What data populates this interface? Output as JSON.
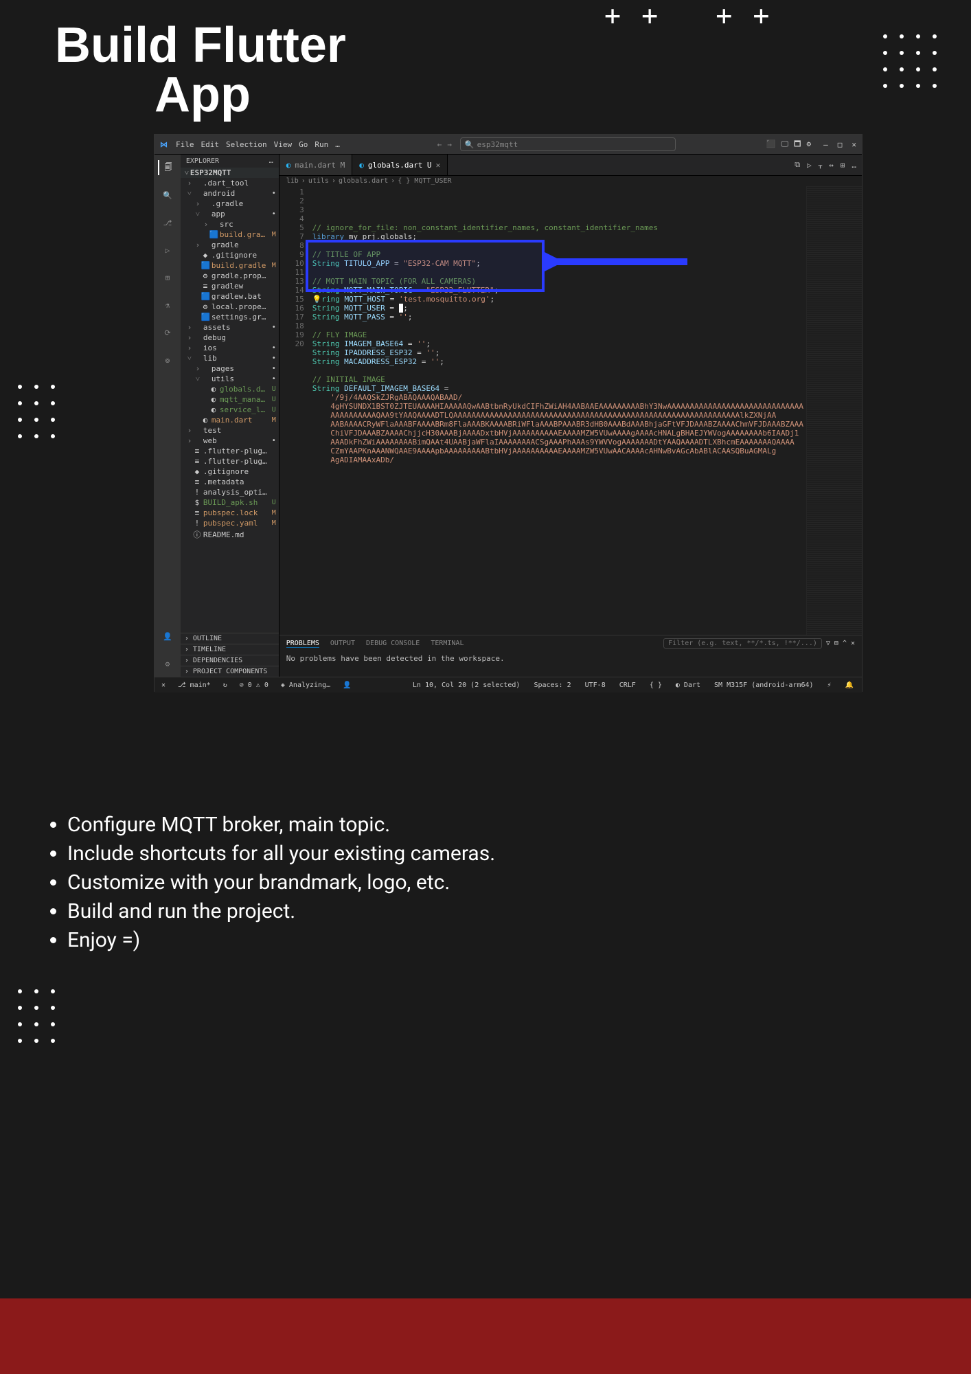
{
  "heading_l1": "Build Flutter",
  "heading_l2": "App",
  "crosses": "++ ++",
  "steps": [
    "Configure MQTT broker, main topic.",
    "Include shortcuts for all your existing cameras.",
    "Customize with your brandmark, logo, etc.",
    "Build and run the project.",
    "Enjoy =)"
  ],
  "menu": [
    "File",
    "Edit",
    "Selection",
    "View",
    "Go",
    "Run",
    "…"
  ],
  "search_placeholder": "esp32mqtt",
  "titlebar_icons": [
    "⬛",
    "🖵",
    "🗖",
    "⚙"
  ],
  "win_controls": [
    "—",
    "□",
    "✕"
  ],
  "explorer_title": "EXPLORER",
  "project_name": "ESP32MQTT",
  "tree": [
    {
      "d": 0,
      "c": "›",
      "i": "",
      "n": ".dart_tool",
      "s": "",
      "cls": ""
    },
    {
      "d": 0,
      "c": "˅",
      "i": "",
      "n": "android",
      "s": "•",
      "cls": ""
    },
    {
      "d": 1,
      "c": "›",
      "i": "",
      "n": ".gradle",
      "s": "",
      "cls": ""
    },
    {
      "d": 1,
      "c": "˅",
      "i": "",
      "n": "app",
      "s": "•",
      "cls": ""
    },
    {
      "d": 2,
      "c": "›",
      "i": "",
      "n": "src",
      "s": "",
      "cls": ""
    },
    {
      "d": 2,
      "c": "",
      "i": "🟦",
      "n": "build.gradle",
      "s": "M",
      "cls": "m"
    },
    {
      "d": 1,
      "c": "›",
      "i": "",
      "n": "gradle",
      "s": "",
      "cls": ""
    },
    {
      "d": 1,
      "c": "",
      "i": "◆",
      "n": ".gitignore",
      "s": "",
      "cls": ""
    },
    {
      "d": 1,
      "c": "",
      "i": "🟦",
      "n": "build.gradle",
      "s": "M",
      "cls": "m"
    },
    {
      "d": 1,
      "c": "",
      "i": "⚙",
      "n": "gradle.properties",
      "s": "",
      "cls": ""
    },
    {
      "d": 1,
      "c": "",
      "i": "≡",
      "n": "gradlew",
      "s": "",
      "cls": ""
    },
    {
      "d": 1,
      "c": "",
      "i": "🟦",
      "n": "gradlew.bat",
      "s": "",
      "cls": ""
    },
    {
      "d": 1,
      "c": "",
      "i": "⚙",
      "n": "local.properties",
      "s": "",
      "cls": ""
    },
    {
      "d": 1,
      "c": "",
      "i": "🟦",
      "n": "settings.gradle",
      "s": "",
      "cls": ""
    },
    {
      "d": 0,
      "c": "›",
      "i": "",
      "n": "assets",
      "s": "•",
      "cls": ""
    },
    {
      "d": 0,
      "c": "›",
      "i": "",
      "n": "debug",
      "s": "",
      "cls": ""
    },
    {
      "d": 0,
      "c": "›",
      "i": "",
      "n": "ios",
      "s": "•",
      "cls": ""
    },
    {
      "d": 0,
      "c": "˅",
      "i": "",
      "n": "lib",
      "s": "•",
      "cls": ""
    },
    {
      "d": 1,
      "c": "›",
      "i": "",
      "n": "pages",
      "s": "•",
      "cls": ""
    },
    {
      "d": 1,
      "c": "˅",
      "i": "",
      "n": "utils",
      "s": "•",
      "cls": ""
    },
    {
      "d": 2,
      "c": "",
      "i": "◐",
      "n": "globals.dart",
      "s": "U",
      "cls": "u"
    },
    {
      "d": 2,
      "c": "",
      "i": "◐",
      "n": "mqtt_manager.dart",
      "s": "U",
      "cls": "u"
    },
    {
      "d": 2,
      "c": "",
      "i": "◐",
      "n": "service_locator.dart",
      "s": "U",
      "cls": "u"
    },
    {
      "d": 1,
      "c": "",
      "i": "◐",
      "n": "main.dart",
      "s": "M",
      "cls": "m"
    },
    {
      "d": 0,
      "c": "›",
      "i": "",
      "n": "test",
      "s": "",
      "cls": ""
    },
    {
      "d": 0,
      "c": "›",
      "i": "",
      "n": "web",
      "s": "•",
      "cls": ""
    },
    {
      "d": 0,
      "c": "",
      "i": "≡",
      "n": ".flutter-plugins",
      "s": "",
      "cls": ""
    },
    {
      "d": 0,
      "c": "",
      "i": "≡",
      "n": ".flutter-plugins-dependenci…",
      "s": "",
      "cls": ""
    },
    {
      "d": 0,
      "c": "",
      "i": "◆",
      "n": ".gitignore",
      "s": "",
      "cls": ""
    },
    {
      "d": 0,
      "c": "",
      "i": "≡",
      "n": ".metadata",
      "s": "",
      "cls": ""
    },
    {
      "d": 0,
      "c": "",
      "i": "!",
      "n": "analysis_options.yaml",
      "s": "",
      "cls": ""
    },
    {
      "d": 0,
      "c": "",
      "i": "$",
      "n": "BUILD_apk.sh",
      "s": "U",
      "cls": "u"
    },
    {
      "d": 0,
      "c": "",
      "i": "≡",
      "n": "pubspec.lock",
      "s": "M",
      "cls": "m"
    },
    {
      "d": 0,
      "c": "",
      "i": "!",
      "n": "pubspec.yaml",
      "s": "M",
      "cls": "m"
    },
    {
      "d": 0,
      "c": "",
      "i": "ⓘ",
      "n": "README.md",
      "s": "",
      "cls": ""
    }
  ],
  "exp_sections": [
    "OUTLINE",
    "TIMELINE",
    "DEPENDENCIES",
    "PROJECT COMPONENTS"
  ],
  "tabs": [
    {
      "n": "main.dart",
      "s": "M",
      "active": false
    },
    {
      "n": "globals.dart",
      "s": "U",
      "active": true
    }
  ],
  "crumbs": [
    "lib",
    "utils",
    "globals.dart",
    "{ } MQTT_USER"
  ],
  "code_lines": [
    {
      "ln": 1,
      "html": "<span class='c-comment'>// ignore_for_file: non_constant_identifier_names, constant_identifier_names</span>"
    },
    {
      "ln": 2,
      "html": "<span class='c-kw'>library</span> my_prj.globals;"
    },
    {
      "ln": 3,
      "html": ""
    },
    {
      "ln": 4,
      "html": "<span class='c-comment'>// TITLE OF APP</span>"
    },
    {
      "ln": 5,
      "html": "<span class='c-type'>String</span> <span class='c-prop'>TITULO_APP</span> = <span class='c-str'>\"ESP32-CAM MQTT\"</span>;"
    },
    {
      "ln": "",
      "html": ""
    },
    {
      "ln": 7,
      "html": "<span class='c-comment'>// MQTT MAIN TOPIC (FOR ALL CAMERAS)</span>"
    },
    {
      "ln": 8,
      "html": "<span class='c-type'>String</span> <span class='c-prop'>MQTT_MAIN_TOPIC</span> = <span class='c-str'>\"ESP32_FLUTTER\"</span>;"
    },
    {
      "ln": 9,
      "html": "<span class='c-type'>💡ring</span> <span class='c-prop'>MQTT_HOST</span> = <span class='c-str'>'test.mosquitto.org'</span>;"
    },
    {
      "ln": 10,
      "html": "<span class='c-type'>String</span> <span class='c-prop'>MQTT_USER</span> = <span style='background:#fff;color:#000'>&nbsp;</span>;"
    },
    {
      "ln": 11,
      "html": "<span class='c-type'>String</span> <span class='c-prop'>MQTT_PASS</span> = <span class='c-str'>''</span>;"
    },
    {
      "ln": "",
      "html": ""
    },
    {
      "ln": 13,
      "html": "<span class='c-comment'>// FLY IMAGE</span>"
    },
    {
      "ln": 14,
      "html": "<span class='c-type'>String</span> <span class='c-prop'>IMAGEM_BASE64</span> = <span class='c-str'>''</span>;"
    },
    {
      "ln": 15,
      "html": "<span class='c-type'>String</span> <span class='c-prop'>IPADDRESS_ESP32</span> = <span class='c-str'>''</span>;"
    },
    {
      "ln": 16,
      "html": "<span class='c-type'>String</span> <span class='c-prop'>MACADDRESS_ESP32</span> = <span class='c-str'>''</span>;"
    },
    {
      "ln": 17,
      "html": ""
    },
    {
      "ln": 18,
      "html": "<span class='c-comment'>// INITIAL IMAGE</span>"
    },
    {
      "ln": 19,
      "html": "<span class='c-type'>String</span> <span class='c-prop'>DEFAULT_IMAGEM_BASE64</span> ="
    },
    {
      "ln": 20,
      "html": "    <span class='c-str'>'/9j/4AAQSkZJRgABAQAAAQABAAD/</span>"
    },
    {
      "ln": "",
      "html": "    <span class='c-str'>4gHYSUNDX1BST0ZJTEUAAAAHIAAAAAQwAABtbnRyUkdCIFhZWiAH4AABAAEAAAAAAAAABhY3Nw</span><span class='c-str'>AAAAAAAAAAAAAAAAAAAAAAAAAAAAAA</span>"
    },
    {
      "ln": "",
      "html": "    <span class='c-str'>AAAAAAAAAAQAA9tYAAQAAAADTLQAAAAAAAAAAAAAAAAAAAAAAAAAAAAAAAAAAAAAAAAAAAAAAAAAAAAAAAAAAAAAAAlkZXNjAA</span>"
    },
    {
      "ln": "",
      "html": "    <span class='c-str'>AABAAAACRyWFlaAAABFAAAABRm8FlaAAABKAAAABRiWFlaAAABPAAABR3dHB0AAABdAAABhjaGFtVFJDAAABZAAAAChmVFJDAAABZAAA</span>"
    },
    {
      "ln": "",
      "html": "    <span class='c-str'>ChiVFJDAAABZAAAAChjjcH30AAABjAAAADxtbHVjAAAAAAAAAAEAAAAMZW5VUwAAAAgAAAAcHNALgBHAEJYWVogAAAAAAAAb6IAADj1</span>"
    },
    {
      "ln": "",
      "html": "    <span class='c-str'>AAADkFhZWiAAAAAAAABimQAAt4UAABjaWFlaIAAAAAAAACSgAAAPhAAAs9YWVVogAAAAAAADtYAAQAAAADTLXBhcmEAAAAAAAQAAAA</span>"
    },
    {
      "ln": "",
      "html": "    <span class='c-str'>CZmYAAPKnAAANWQAAE9AAAApbAAAAAAAAABtbHVjAAAAAAAAAAEAAAAMZW5VUwAACAAAAcAH</span><span class='c-str'>NwBvAGcAbABlACAASQBuAGMALg</span>"
    },
    {
      "ln": "",
      "html": "    <span class='c-str'>AgADIAMAAxADb/</span>"
    }
  ],
  "panel_tabs": [
    "PROBLEMS",
    "OUTPUT",
    "DEBUG CONSOLE",
    "TERMINAL"
  ],
  "panel_filter": "Filter (e.g. text, **/*.ts, !**/...)",
  "panel_msg": "No problems have been detected in the workspace.",
  "status_left": [
    "✕",
    "⎇ main*",
    "↻",
    "⊘ 0 ⚠ 0",
    "◈ Analyzing…",
    "👤"
  ],
  "status_right": [
    "Ln 10, Col 20 (2 selected)",
    "Spaces: 2",
    "UTF-8",
    "CRLF",
    "{ }",
    "◐ Dart",
    "SM M315F (android-arm64)",
    "⚡",
    "🔔"
  ]
}
